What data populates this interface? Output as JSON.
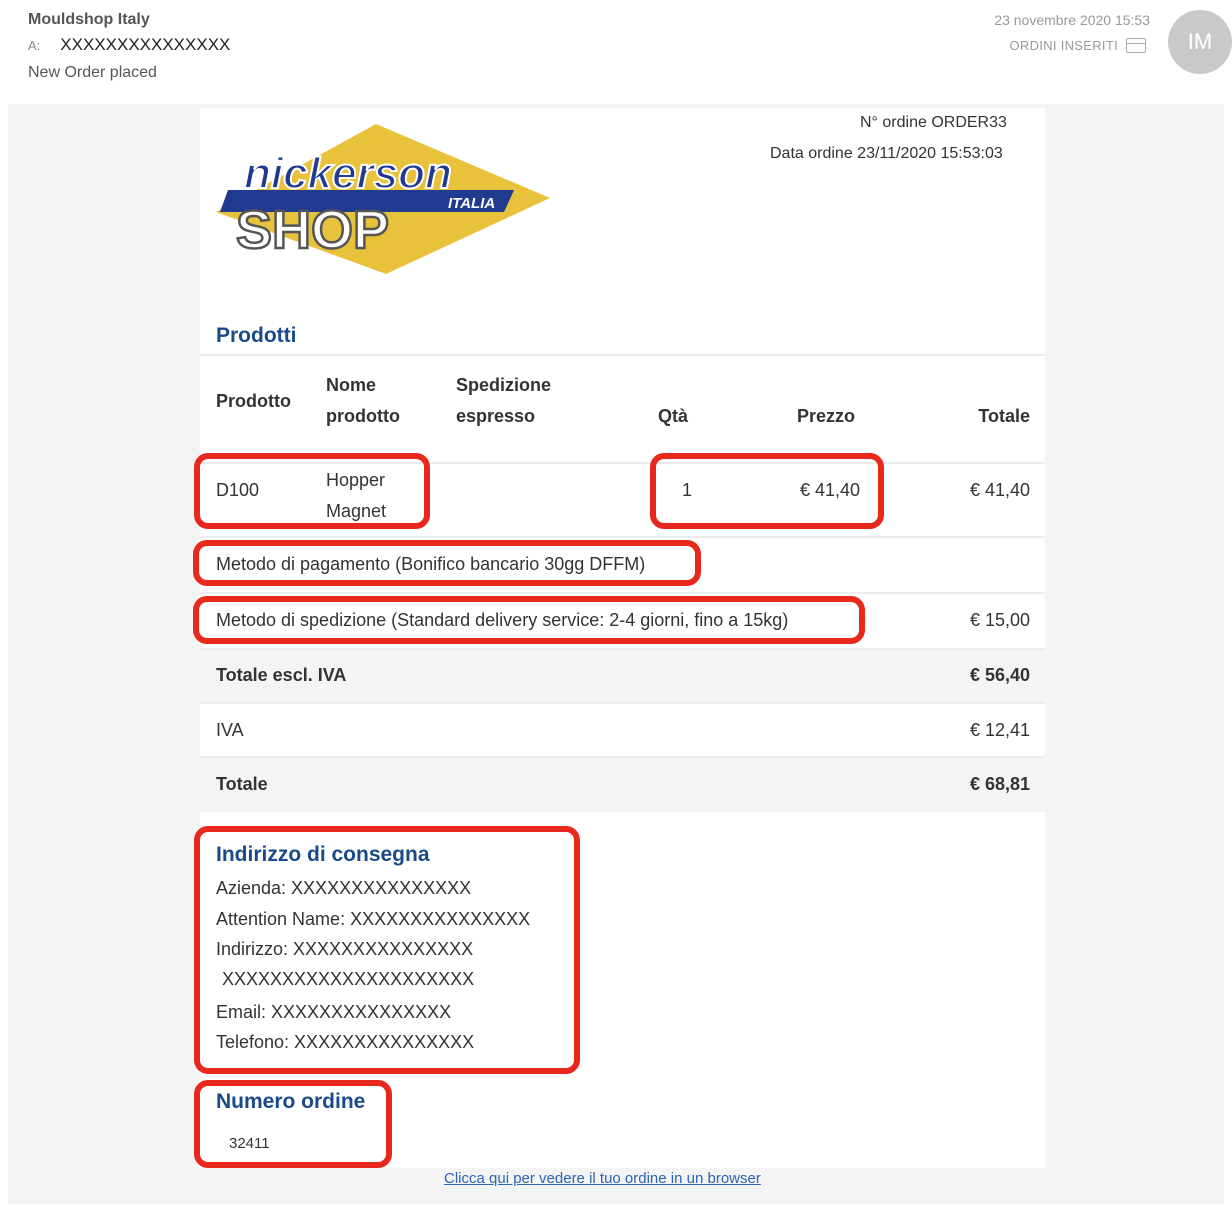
{
  "mail": {
    "sender": "Mouldshop Italy",
    "to_label": "A:",
    "to_value": "XXXXXXXXXXXXXXX",
    "subject": "New Order placed",
    "date": "23 novembre 2020 15:53",
    "folder": "ORDINI INSERITI",
    "avatar_initials": "IM"
  },
  "order": {
    "number_line": "N° ordine ORDER33",
    "date_line": "Data ordine 23/11/2020 15:53:03"
  },
  "logo": {
    "top_text": "nickerson",
    "sub_text": "ITALIA",
    "bottom_text": "SHOP",
    "colors": {
      "diamond": "#e8c23a",
      "band": "#1f3a8f",
      "text": "#ffffff"
    }
  },
  "products": {
    "title": "Prodotti",
    "headers": {
      "product": "Prodotto",
      "name_1": "Nome",
      "name_2": "prodotto",
      "shipping_1": "Spedizione",
      "shipping_2": "espresso",
      "qty": "Qtà",
      "price": "Prezzo",
      "total": "Totale"
    },
    "rows": [
      {
        "code": "D100",
        "name_1": "Hopper",
        "name_2": "Magnet",
        "qty": "1",
        "price": "€ 41,40",
        "total": "€ 41,40"
      }
    ]
  },
  "payment": {
    "label": "Metodo di pagamento (Bonifico bancario 30gg DFFM)"
  },
  "shipping": {
    "label": "Metodo di spedizione (Standard delivery service: 2-4 giorni, fino a 15kg)",
    "amount": "€ 15,00"
  },
  "totals": {
    "subtotal_label": "Totale escl. IVA",
    "subtotal_value": "€ 56,40",
    "vat_label": "IVA",
    "vat_value": "€ 12,41",
    "total_label": "Totale",
    "total_value": "€ 68,81"
  },
  "delivery": {
    "title": "Indirizzo di consegna",
    "company": "Azienda:  XXXXXXXXXXXXXXX",
    "attention": "Attention Name:  XXXXXXXXXXXXXXX",
    "address": "Indirizzo:  XXXXXXXXXXXXXXX",
    "address_2": " XXXXXXXXXXXXXXXXXXXXX",
    "email": "Email:  XXXXXXXXXXXXXXX",
    "phone": "Telefono:  XXXXXXXXXXXXXXX"
  },
  "order_number": {
    "title": "Numero ordine",
    "value": "32411"
  },
  "browser_link": "Clicca qui per vedere il tuo ordine in un browser",
  "annotation_color": "#e8281c"
}
